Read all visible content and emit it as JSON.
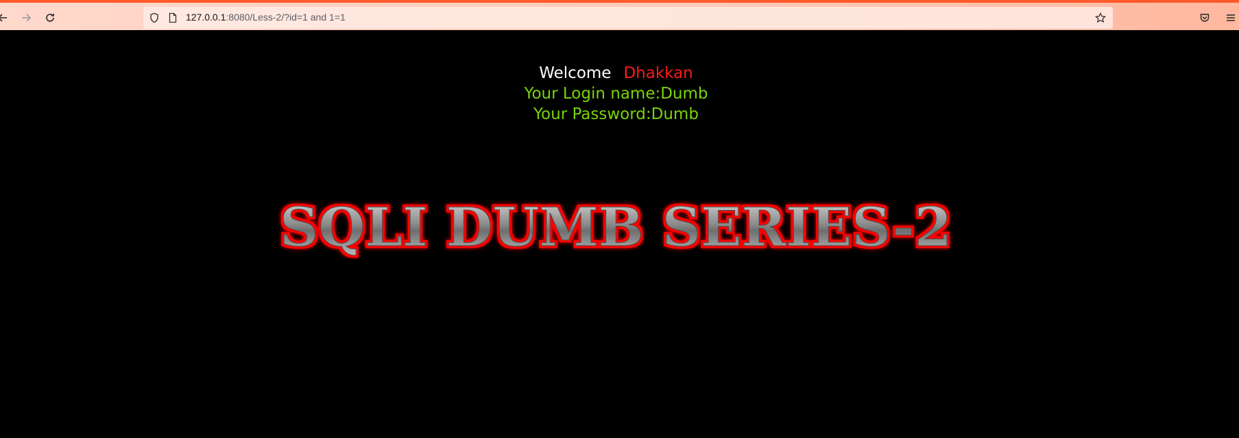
{
  "browser": {
    "url_host": "127.0.0.1",
    "url_rest": ":8080/Less-2/?id=1 and 1=1",
    "icons": [
      "back-icon",
      "forward-icon",
      "reload-icon",
      "shield-icon",
      "page-icon",
      "star-icon",
      "pocket-icon",
      "menu-icon"
    ]
  },
  "page": {
    "welcome_label": "Welcome",
    "welcome_name": "Dhakkan",
    "login_line": "Your Login name:Dumb",
    "password_line": "Your Password:Dumb",
    "logo_text": "SQLI DUMB SERIES-2"
  },
  "colors": {
    "background": "#000000",
    "welcome_name": "#ff1a1a",
    "info_text": "#79d40a",
    "toolbar_accent": "#ff5a2b"
  }
}
